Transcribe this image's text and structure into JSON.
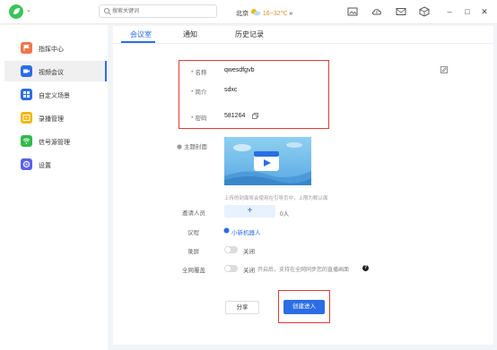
{
  "topbar": {
    "search_placeholder": "搜索关键词",
    "city": "北京",
    "temperature": "16~32℃",
    "weather_more": "»",
    "window_controls": [
      "–",
      "□",
      "✕"
    ]
  },
  "sidebar": {
    "items": [
      {
        "label": "指挥中心",
        "icon": "flag-icon",
        "color": "#f0764a"
      },
      {
        "label": "视频会议",
        "icon": "video-camera-icon",
        "color": "#2b6de5"
      },
      {
        "label": "自定义场景",
        "icon": "grid-icon",
        "color": "#2b6de5"
      },
      {
        "label": "录播管理",
        "icon": "record-icon",
        "color": "#f5b400"
      },
      {
        "label": "信号源管理",
        "icon": "wifi-icon",
        "color": "#34b84e"
      },
      {
        "label": "设置",
        "icon": "settings-icon",
        "color": "#5b62e8"
      }
    ],
    "active_index": 1
  },
  "tabs": [
    "会议室",
    "通知",
    "历史记录"
  ],
  "active_tab": 0,
  "form": {
    "name_label": "名称",
    "name_value": "qwesdfgvb",
    "intro_label": "简介",
    "intro_value": "sdxc",
    "password_label": "密码",
    "password_value": "581264",
    "cover_label": "主题封面",
    "cover_hint": "上传的封面将会使用在引导页中，上限为默认面",
    "invite_label": "邀请人员",
    "invite_add": "+",
    "invite_count": "0人",
    "agenda_label": "议程",
    "agenda_value": "小新机器人",
    "record_label": "录屏",
    "record_state": "关闭",
    "broadcast_label": "全网覆盖",
    "broadcast_state": "关闭",
    "broadcast_hint": "开启后，支持在全网同步您的直播画面",
    "help_glyph": "?"
  },
  "buttons": {
    "share": "分享",
    "create": "创建进入"
  },
  "colors": {
    "accent": "#2b6de5",
    "highlight": "#e53935"
  }
}
